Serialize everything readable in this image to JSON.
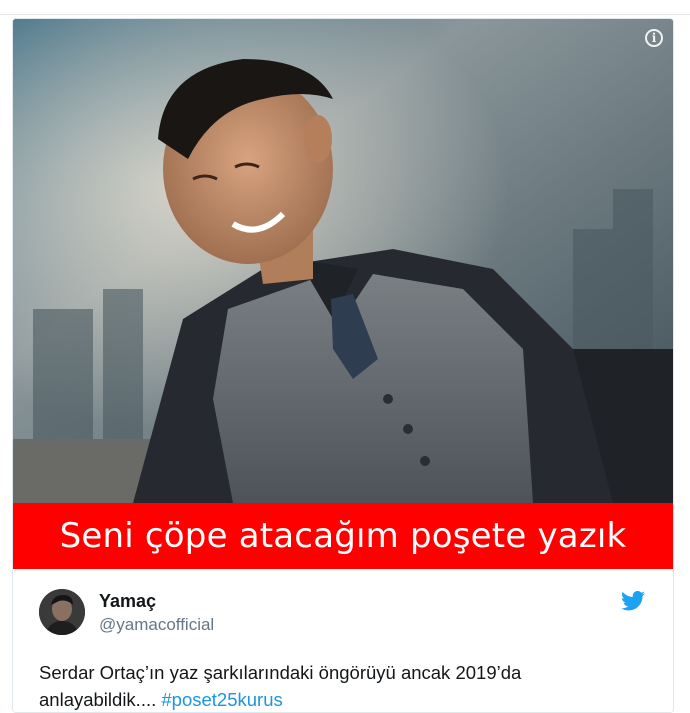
{
  "caption": {
    "text": "Seni çöpe atacağım poşete yazık",
    "bg_color": "#ff0000"
  },
  "tweet": {
    "display_name": "Yamaç",
    "handle": "@yamacofficial",
    "text_before": "Serdar Ortaç’ın yaz şarkılarındaki öngörüyü ancak 2019’da anlayabildik.... ",
    "hashtag": "#poset25kurus",
    "hashtag_color": "#1b95e0"
  },
  "icons": {
    "info": "info-icon",
    "twitter": "twitter-bird-icon"
  }
}
